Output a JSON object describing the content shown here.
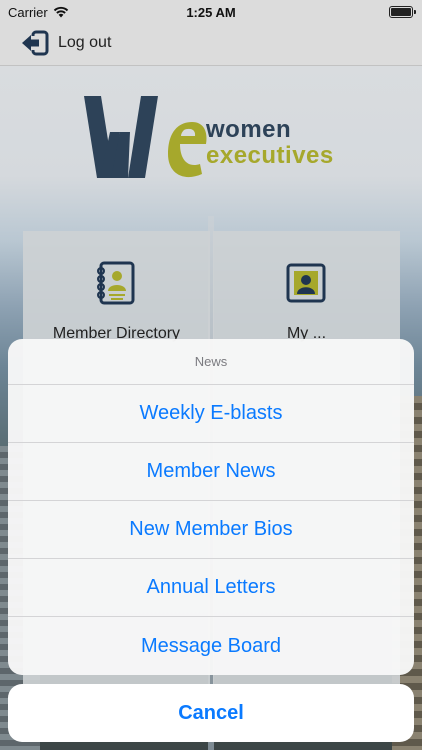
{
  "status_bar": {
    "carrier": "Carrier",
    "time": "1:25 AM"
  },
  "nav": {
    "logout_label": "Log out"
  },
  "logo": {
    "line1": "women",
    "line2": "executives"
  },
  "tiles": [
    {
      "label": "Member Directory",
      "icon": "address-book-icon"
    },
    {
      "label": "My ...",
      "icon": "profile-card-icon"
    }
  ],
  "action_sheet": {
    "title": "News",
    "actions": [
      "Weekly E-blasts",
      "Member News",
      "New Member Bios",
      "Annual Letters",
      "Message Board"
    ],
    "cancel": "Cancel"
  },
  "colors": {
    "accent": "#0a7aff",
    "navy": "#2d4258",
    "olive": "#a6a82c"
  }
}
